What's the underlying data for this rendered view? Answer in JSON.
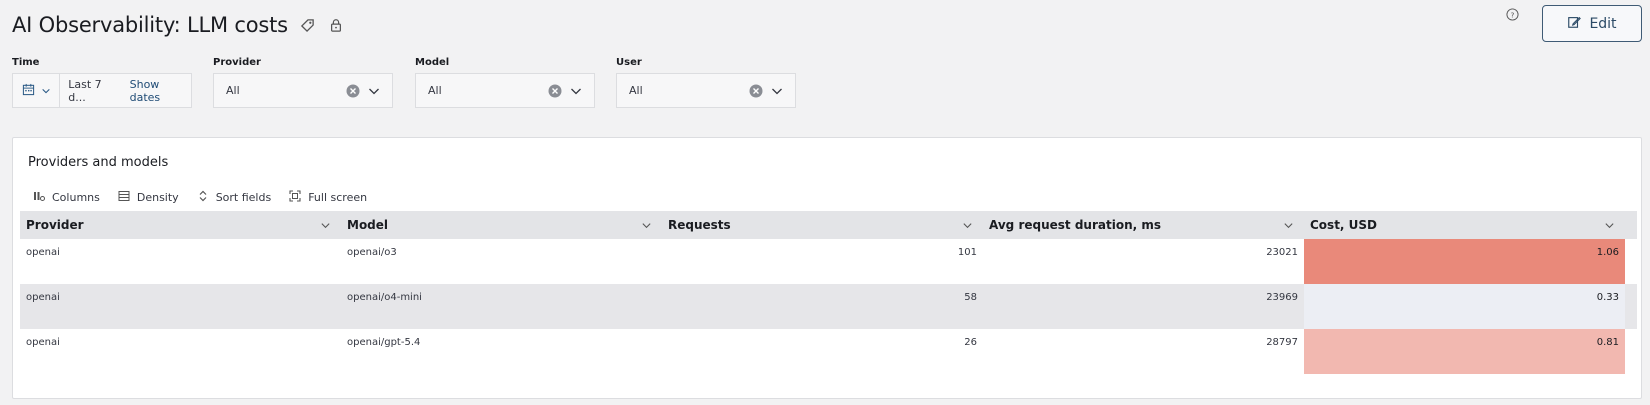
{
  "page": {
    "title": "AI Observability: LLM costs",
    "edit_label": "Edit"
  },
  "icons": {
    "tag": "tag-icon",
    "lock": "lock-icon",
    "help": "question-circle-icon",
    "edit": "pencil-icon",
    "calendar": "calendar-icon",
    "clear": "clear-circle-icon",
    "chevron": "chevron-down-icon"
  },
  "controls": {
    "time": {
      "label": "Time",
      "value": "Last 7 d...",
      "show_dates": "Show dates"
    },
    "provider": {
      "label": "Provider",
      "value": "All"
    },
    "model": {
      "label": "Model",
      "value": "All"
    },
    "user": {
      "label": "User",
      "value": "All"
    }
  },
  "panel": {
    "title": "Providers and models",
    "toolbar": {
      "columns": "Columns",
      "density": "Density",
      "sort_fields": "Sort fields",
      "full_screen": "Full screen"
    },
    "columns": [
      "Provider",
      "Model",
      "Requests",
      "Avg request duration, ms",
      "Cost, USD"
    ],
    "rows": [
      [
        "openai",
        "openai/o3",
        "101",
        "23021",
        "1.06"
      ],
      [
        "openai",
        "openai/o4-mini",
        "58",
        "23969",
        "0.33"
      ],
      [
        "openai",
        "openai/gpt-5.4",
        "26",
        "28797",
        "0.81"
      ]
    ]
  },
  "colors": {
    "cost_high": "#e9897a",
    "cost_low": "#eceef4",
    "cost_mid": "#f2b8b0",
    "accent": "#2b4a66"
  }
}
